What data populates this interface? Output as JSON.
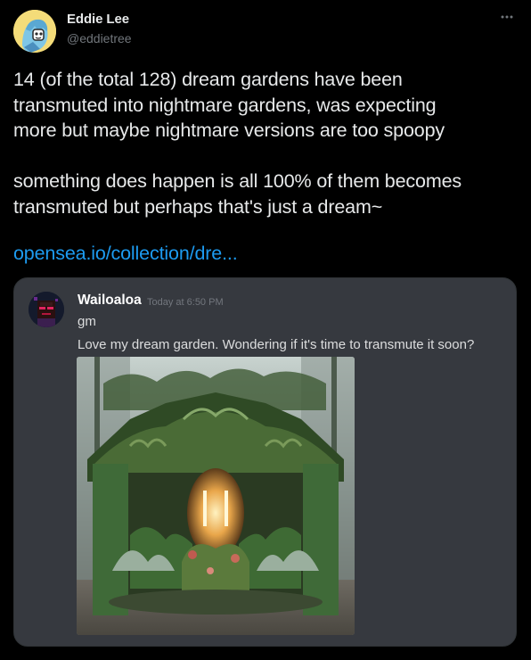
{
  "tweet": {
    "author_name": "Eddie Lee",
    "author_handle": "@eddietree",
    "text": "14 (of the total 128) dream gardens have been\ntransmuted into nightmare gardens, was expecting\nmore but maybe nightmare versions are too spoopy\n\nsomething does happen is all 100% of them becomes\ntransmuted but perhaps that's just a dream~",
    "link_text": "opensea.io/collection/dre...",
    "more_icon": "ellipsis-icon"
  },
  "embed": {
    "username": "Wailoaloa",
    "timestamp": "Today at 6:50 PM",
    "message_line_1": "gm",
    "message_line_2": "Love my dream garden. Wondering if it's time to transmute it soon?",
    "image_icon": "dream-garden-image"
  },
  "colors": {
    "background": "#000000",
    "text": "#e7e9ea",
    "secondary": "#71767b",
    "link": "#1d9bf0",
    "embed_bg": "#36393f"
  }
}
